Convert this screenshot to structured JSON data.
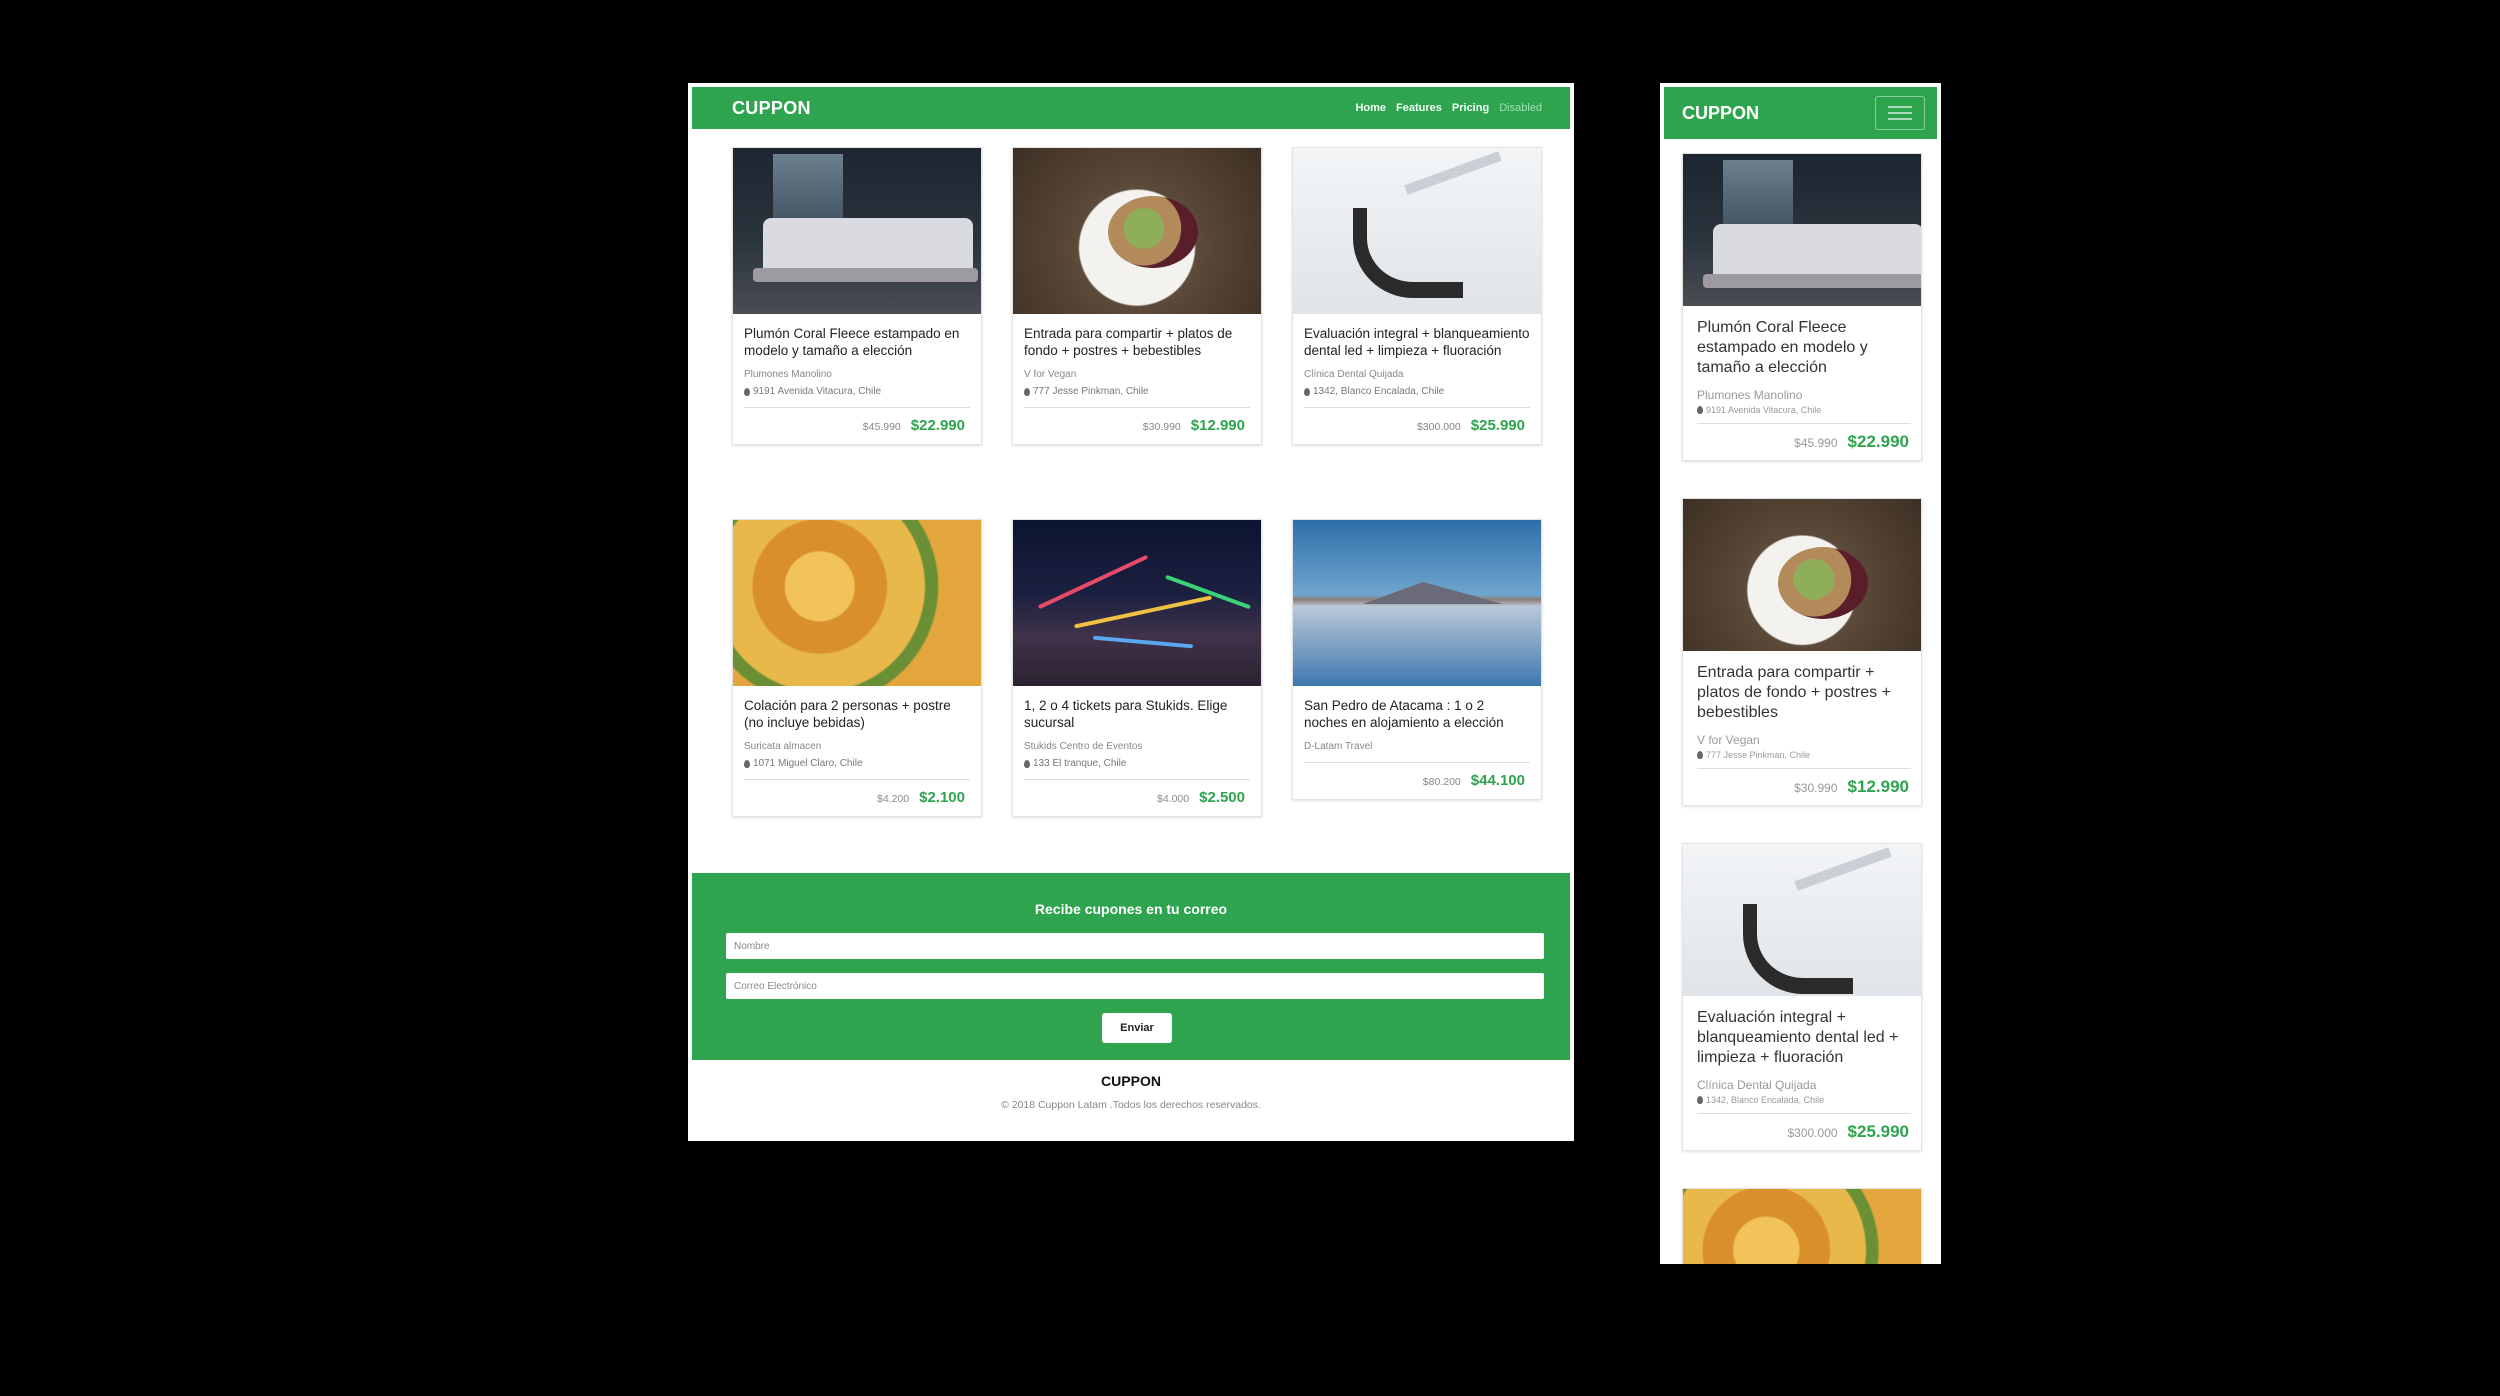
{
  "brand": "CUPPON",
  "nav": {
    "links": [
      {
        "label": "Home",
        "active": true
      },
      {
        "label": "Features",
        "active": false
      },
      {
        "label": "Pricing",
        "active": false
      },
      {
        "label": "Disabled",
        "active": false,
        "disabled": true
      }
    ]
  },
  "products": [
    {
      "title": "Plumón Coral Fleece estampado en modelo y tamaño a elección",
      "company": "Plumones Manolino",
      "address": "9191 Avenida Vitacura, Chile",
      "old_price": "$45.990",
      "price": "$22.990",
      "image": "bedroom"
    },
    {
      "title": "Entrada para compartir + platos de fondo + postres + bebestibles",
      "company": "V for Vegan",
      "address": "777 Jesse Pinkman, Chile",
      "old_price": "$30.990",
      "price": "$12.990",
      "image": "salad"
    },
    {
      "title": "Evaluación integral + blanqueamiento dental led + limpieza + fluoración",
      "company": "Clínica Dental Quijada",
      "address": "1342, Blanco Encalada, Chile",
      "old_price": "$300.000",
      "price": "$25.990",
      "image": "dental"
    },
    {
      "title": "Colación para 2 personas + postre (no incluye bebidas)",
      "company": "Suricata almacen",
      "address": "1071 Miguel Claro, Chile",
      "old_price": "$4.200",
      "price": "$2.100",
      "image": "stew"
    },
    {
      "title": "1, 2 o 4 tickets para Stukids. Elige sucursal",
      "company": "Stukids Centro de Eventos",
      "address": "133 El tranque, Chile",
      "old_price": "$4.000",
      "price": "$2.500",
      "image": "night"
    },
    {
      "title": "San Pedro de Atacama : 1 o 2 noches en alojamiento a elección",
      "company": "D-Latam Travel",
      "address": "",
      "old_price": "$80.200",
      "price": "$44.100",
      "image": "lake"
    }
  ],
  "newsletter": {
    "title": "Recibe cupones en tu correo",
    "name_placeholder": "Nombre",
    "email_placeholder": "Correo Electrónico",
    "button": "Enviar"
  },
  "footer": {
    "brand": "CUPPON",
    "copyright": "© 2018 Cuppon Latam .Todos los derechos reservados."
  },
  "colors": {
    "accent": "#2ea44f",
    "background": "#000000"
  },
  "icons": {
    "address": "map-pin-icon",
    "menu": "hamburger-menu-icon"
  }
}
